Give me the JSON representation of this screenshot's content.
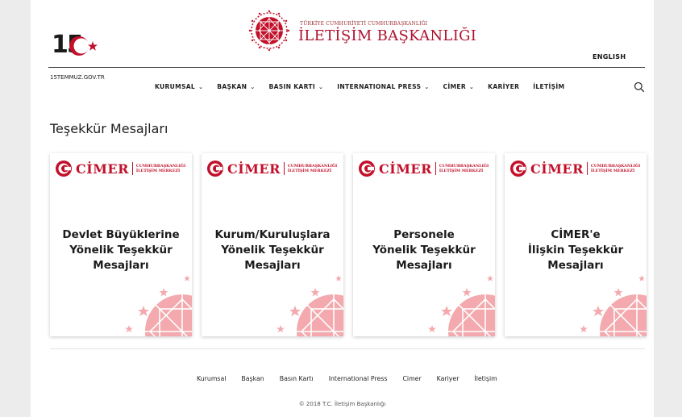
{
  "header": {
    "anniversary_number": "15",
    "anniversary_url": "15TEMMUZ.GOV.TR",
    "brand_small": "TÜRKİYE CUMHURİYETİ CUMHURBAŞKANLIĞI",
    "brand_big": "İLETİŞİM BAŞKANLIĞI",
    "language_link": "ENGLISH"
  },
  "nav": {
    "items": [
      {
        "label": "KURUMSAL",
        "dropdown": true
      },
      {
        "label": "BAŞKAN",
        "dropdown": true
      },
      {
        "label": "BASIN KARTI",
        "dropdown": true
      },
      {
        "label": "INTERNATIONAL PRESS",
        "dropdown": true
      },
      {
        "label": "CİMER",
        "dropdown": true
      },
      {
        "label": "KARİYER",
        "dropdown": false
      },
      {
        "label": "İLETİŞİM",
        "dropdown": false
      }
    ],
    "search_icon": "search-icon"
  },
  "page_title": "Teşekkür Mesajları",
  "cimer": {
    "word": "CİMER",
    "sub_line1": "CUMHURBAŞKANLIĞI",
    "sub_line2": "İLETİŞİM MERKEZİ"
  },
  "cards": [
    {
      "title_lines": [
        "Devlet Büyüklerine",
        "Yönelik Teşekkür",
        "Mesajları"
      ]
    },
    {
      "title_lines": [
        "Kurum/Kuruluşlara",
        "Yönelik Teşekkür",
        "Mesajları"
      ]
    },
    {
      "title_lines": [
        "Personele",
        "Yönelik Teşekkür",
        "Mesajları"
      ]
    },
    {
      "title_lines": [
        "CİMER'e",
        "İlişkin Teşekkür",
        "Mesajları"
      ]
    }
  ],
  "footer": {
    "links": [
      "Kurumsal",
      "Başkan",
      "Basın Kartı",
      "International Press",
      "Cimer",
      "Kariyer",
      "İletişim"
    ],
    "copyright": "© 2018 T.C. İletişim Başkanlığı"
  },
  "colors": {
    "brand_red": "#c2102a",
    "page_bg": "#ffffff",
    "outer_bg": "#ececec",
    "art_pink": "#f3a9ad"
  }
}
